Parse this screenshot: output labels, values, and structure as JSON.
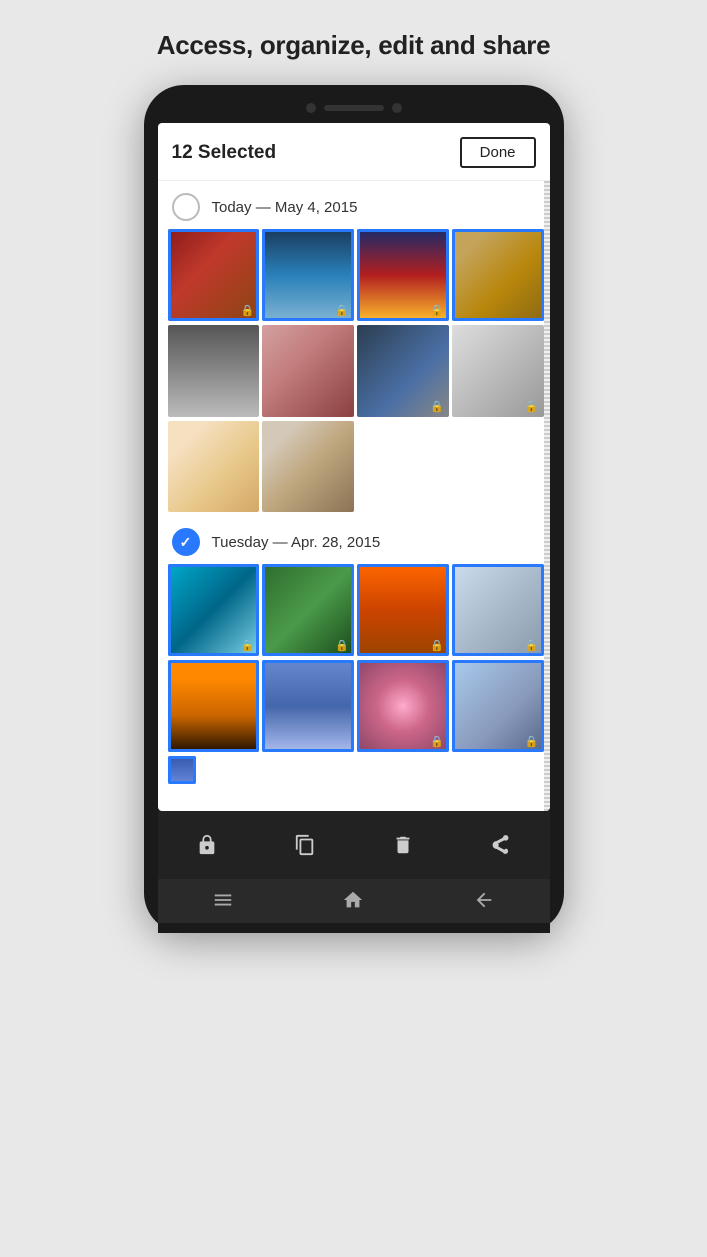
{
  "page": {
    "title": "Access, organize, edit and share"
  },
  "app": {
    "selected_count": "12 Selected",
    "done_button": "Done",
    "section1": {
      "label": "Today — May 4, 2015",
      "checked": false
    },
    "section2": {
      "label": "Tuesday — Apr. 28, 2015",
      "checked": true
    }
  },
  "toolbar": {
    "lock_icon": "🔒",
    "copy_icon": "⧉",
    "delete_icon": "🗑",
    "share_icon": "↗"
  },
  "nav": {
    "menu_icon": "☰",
    "home_icon": "⌂",
    "back_icon": "←"
  }
}
